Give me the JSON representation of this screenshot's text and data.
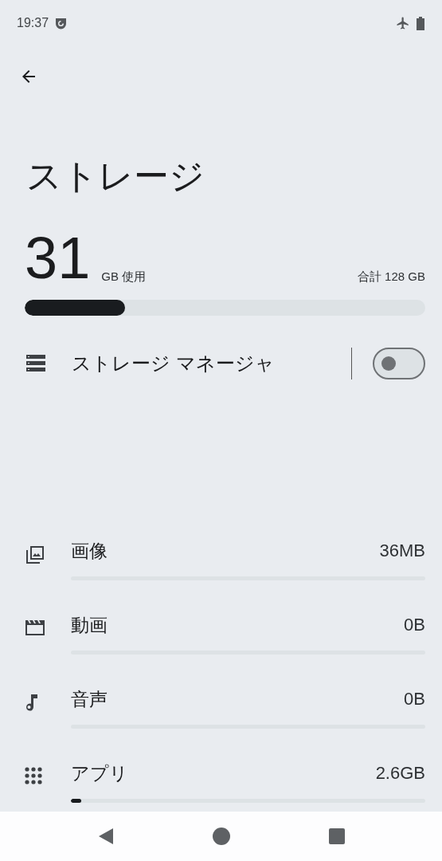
{
  "status_bar": {
    "time": "19:37"
  },
  "title": "ストレージ",
  "usage": {
    "used": "31",
    "used_unit": "GB 使用",
    "total": "合計 128 GB",
    "level": 0.25
  },
  "storage_manager": {
    "label": "ストレージ マネージャ",
    "on": false
  },
  "categories": [
    {
      "kind": "images",
      "label": "画像",
      "size": "36MB"
    },
    {
      "kind": "videos",
      "label": "動画",
      "size": "0B"
    },
    {
      "kind": "audio",
      "label": "音声",
      "size": "0B"
    },
    {
      "kind": "apps",
      "label": "アプリ",
      "size": "2.6GB",
      "level": 0.03
    }
  ]
}
